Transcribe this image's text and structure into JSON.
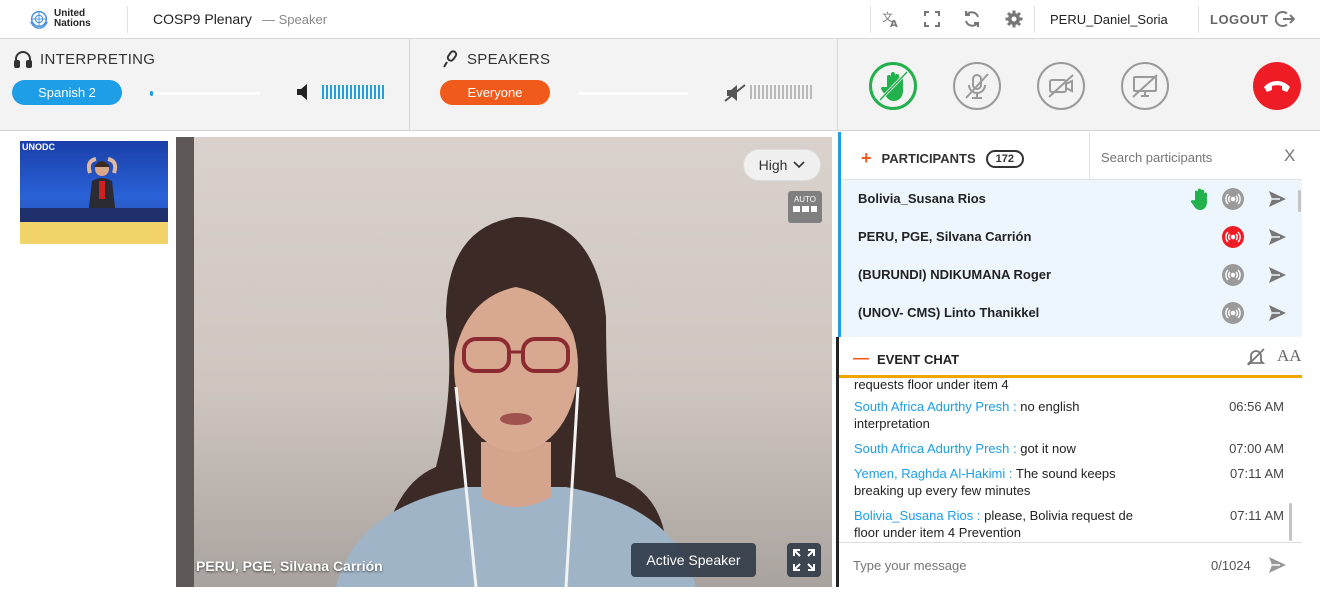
{
  "topbar": {
    "logo_text": "United Nations",
    "event_title": "COSP9 Plenary",
    "event_role": "— Speaker",
    "username": "PERU_Daniel_Soria",
    "logout_label": "LOGOUT",
    "icons": [
      "translate-icon",
      "fullscreen-icon",
      "refresh-icon",
      "gear-icon",
      "logout-icon"
    ]
  },
  "interpreting": {
    "title": "INTERPRETING",
    "language": "Spanish 2",
    "input_level": 0.03,
    "output_volume": 1.0
  },
  "speakers": {
    "title": "SPEAKERS",
    "audience": "Everyone",
    "input_level": 0.0,
    "output_volume": 0.0,
    "muted": true
  },
  "controls": {
    "raise_hand_active": true,
    "mic_muted": true,
    "camera_off": true,
    "screen_share_off": true,
    "colors": {
      "active_green": "#22b14c",
      "hangup_red": "#ee1c25",
      "accent_blue": "#1d9ee6",
      "accent_orange": "#f05a1a"
    }
  },
  "thumbnail": {
    "logo": "UNODC"
  },
  "video": {
    "quality": "High",
    "auto_label": "AUTO",
    "speaker_name": "PERU, PGE, Silvana Carrión",
    "active_speaker_label": "Active Speaker"
  },
  "participants": {
    "title": "PARTICIPANTS",
    "count": "172",
    "search_placeholder": "Search participants",
    "close_label": "X",
    "rows": [
      {
        "name": "Bolivia_Susana Rios",
        "hand_raised": true,
        "audio_live": false
      },
      {
        "name": "PERU, PGE, Silvana Carrión",
        "hand_raised": false,
        "audio_live": true
      },
      {
        "name": "(BURUNDI) NDIKUMANA Roger",
        "hand_raised": false,
        "audio_live": false
      },
      {
        "name": "(UNOV- CMS) Linto Thanikkel",
        "hand_raised": false,
        "audio_live": false
      }
    ]
  },
  "chat": {
    "title": "EVENT CHAT",
    "font_label": "AA",
    "partial_line": "requests floor under item 4",
    "messages": [
      {
        "author": "South Africa Adurthy Presh :",
        "text": "no english interpretation",
        "time": "06:56 AM"
      },
      {
        "author": "South Africa Adurthy Presh :",
        "text": "got it now",
        "time": "07:00 AM"
      },
      {
        "author": "Yemen, Raghda Al-Hakimi :",
        "text": "The sound keeps breaking up every few minutes",
        "time": "07:11 AM"
      },
      {
        "author": "Bolivia_Susana Rios :",
        "text": "please, Bolivia request de floor under item 4 Prevention",
        "time": "07:11 AM"
      }
    ],
    "input_placeholder": "Type your message",
    "char_count": "0/1024"
  }
}
